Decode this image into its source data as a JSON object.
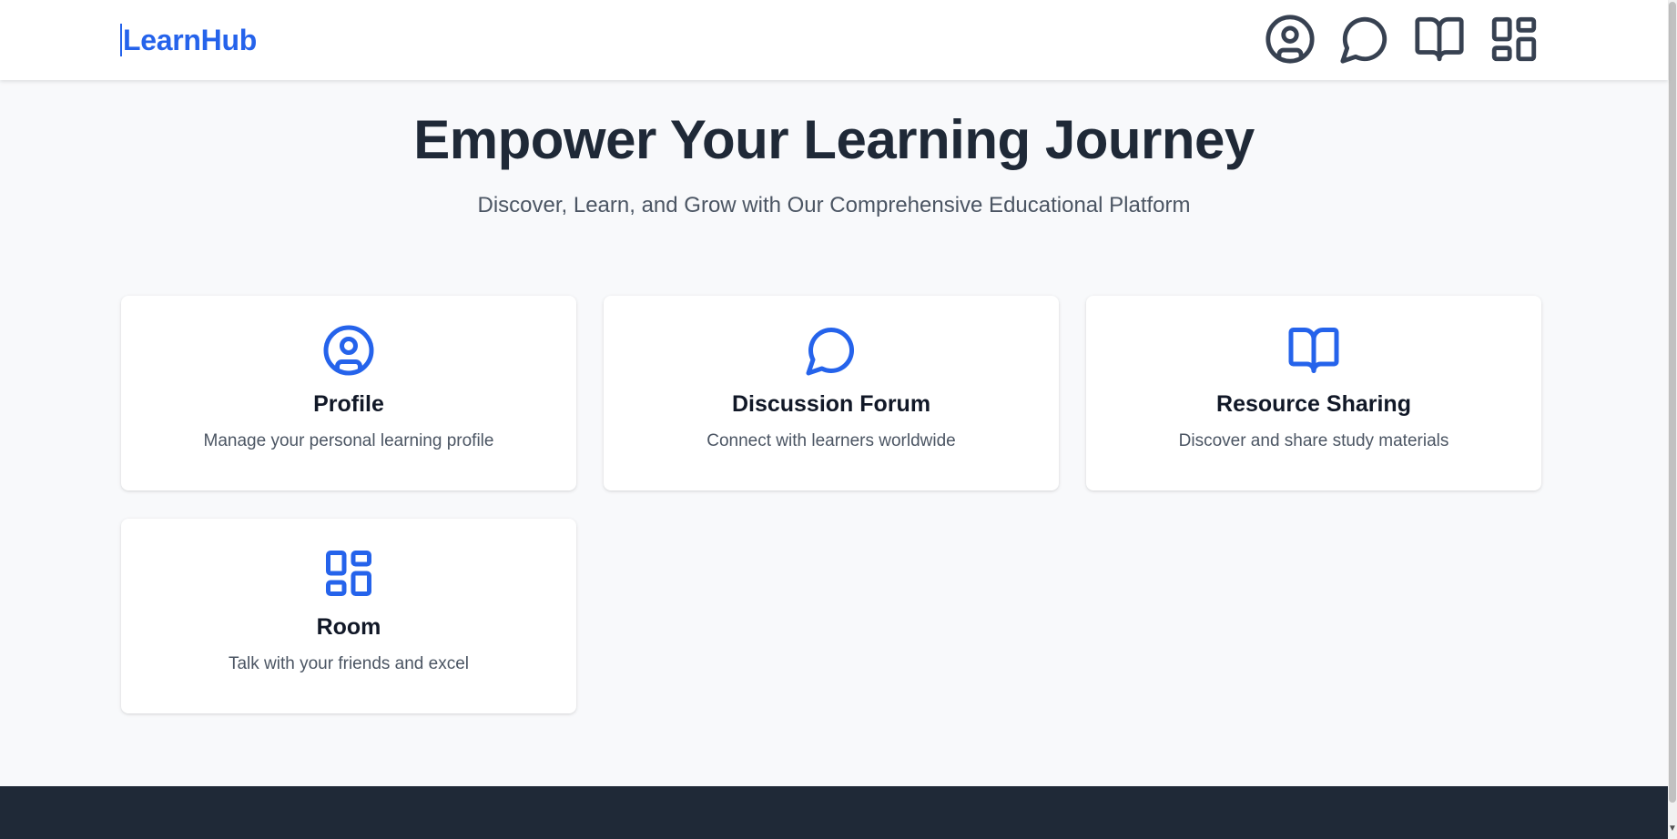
{
  "header": {
    "logo": "LearnHub",
    "nav_icons": [
      "user-circle-icon",
      "chat-bubble-icon",
      "open-book-icon",
      "dashboard-grid-icon"
    ]
  },
  "hero": {
    "title": "Empower Your Learning Journey",
    "subtitle": "Discover, Learn, and Grow with Our Comprehensive Educational Platform"
  },
  "cards": [
    {
      "icon": "user-circle-icon",
      "title": "Profile",
      "description": "Manage your personal learning profile"
    },
    {
      "icon": "chat-bubble-icon",
      "title": "Discussion Forum",
      "description": "Connect with learners worldwide"
    },
    {
      "icon": "open-book-icon",
      "title": "Resource Sharing",
      "description": "Discover and share study materials"
    },
    {
      "icon": "dashboard-grid-icon",
      "title": "Room",
      "description": "Talk with your friends and excel"
    }
  ],
  "colors": {
    "accent": "#2563eb",
    "nav_icon": "#374151",
    "heading": "#1f2937",
    "footer_bg": "#1f2937",
    "page_bg": "#f8f9fb"
  }
}
